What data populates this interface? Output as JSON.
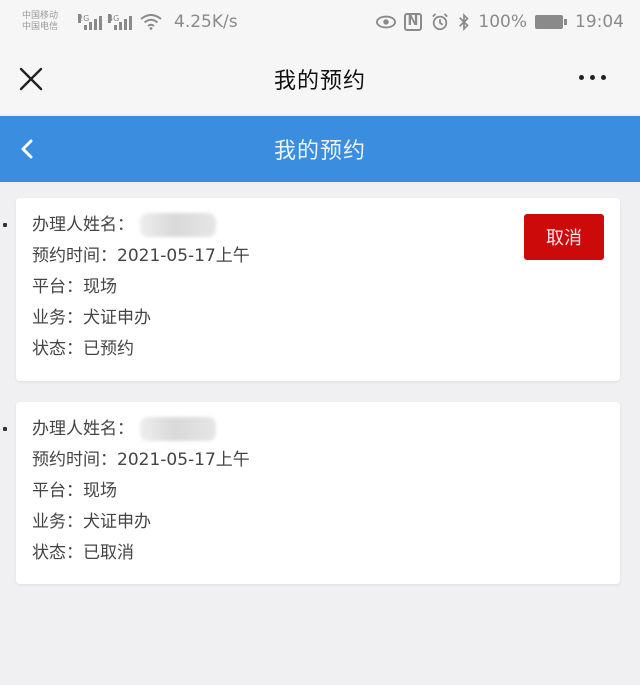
{
  "status_bar": {
    "carrier_1": "中国移动",
    "carrier_2": "中国电信",
    "sim1_gen": "2G",
    "sim2_gen": "4G",
    "net_speed": "4.25K/s",
    "nfc": "N",
    "battery": "100%",
    "time": "19:04"
  },
  "wechat_nav": {
    "title": "我的预约",
    "close_icon": "close-icon",
    "more_icon": "more-icon"
  },
  "header": {
    "title": "我的预约",
    "back_icon": "chevron-left-icon",
    "color": "#3b8de0"
  },
  "reservations": [
    {
      "name_label": "办理人姓名：",
      "time_label": "预约时间：",
      "time_value": "2021-05-17上午",
      "platform_label": "平台：",
      "platform_value": "现场",
      "business_label": "业务：",
      "business_value": "犬证申办",
      "status_label": "状态：",
      "status_value": "已预约",
      "cancel_label": "取消"
    },
    {
      "name_label": "办理人姓名：",
      "time_label": "预约时间：",
      "time_value": "2021-05-17上午",
      "platform_label": "平台：",
      "platform_value": "现场",
      "business_label": "业务：",
      "business_value": "犬证申办",
      "status_label": "状态：",
      "status_value": "已取消"
    }
  ],
  "colors": {
    "cancel_button": "#cc0a0a",
    "background": "#f0f0f2"
  }
}
